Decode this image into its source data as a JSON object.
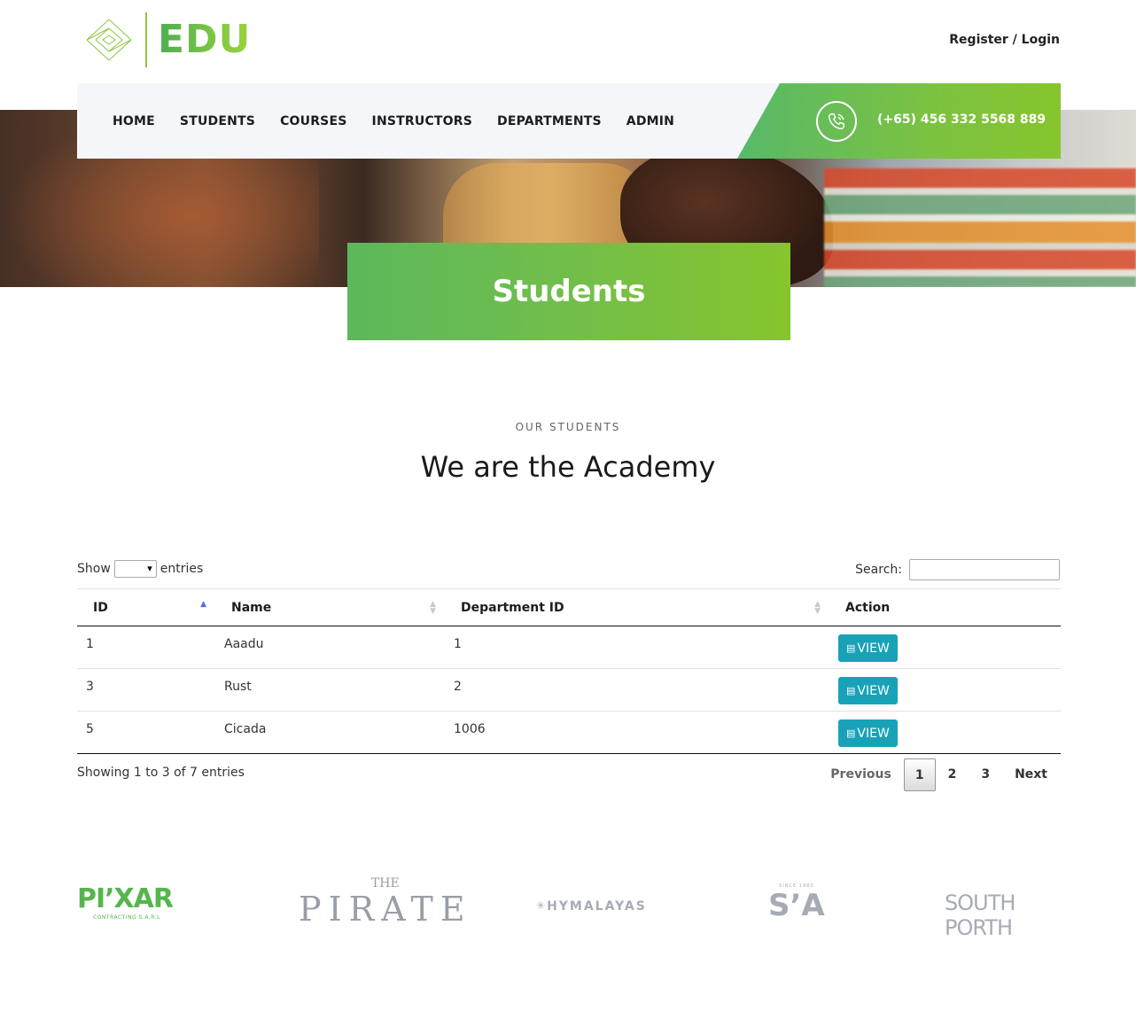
{
  "header": {
    "logo_text": "EDU",
    "register_label": "Register",
    "separator": " / ",
    "login_label": "Login"
  },
  "nav": {
    "items": [
      "HOME",
      "STUDENTS",
      "COURSES",
      "INSTRUCTORS",
      "DEPARTMENTS",
      "ADMIN"
    ],
    "phone": "(+65) 456 332 5568 889",
    "phone_icon": "phone-icon"
  },
  "page": {
    "title": "Students",
    "subtitle": "OUR STUDENTS",
    "headline": "We are the Academy"
  },
  "table": {
    "show_label": "Show",
    "entries_label": "entries",
    "search_label": "Search:",
    "search_value": "",
    "columns": [
      "ID",
      "Name",
      "Department ID",
      "Action"
    ],
    "sorted_column": "ID",
    "rows": [
      {
        "id": "1",
        "name": "Aaadu",
        "department_id": "1",
        "action": "VIEW"
      },
      {
        "id": "3",
        "name": "Rust",
        "department_id": "2",
        "action": "VIEW"
      },
      {
        "id": "5",
        "name": "Cicada",
        "department_id": "1006",
        "action": "VIEW"
      }
    ],
    "info": "Showing 1 to 3 of 7 entries",
    "pagination": {
      "previous": "Previous",
      "pages": [
        "1",
        "2",
        "3"
      ],
      "current": "1",
      "next": "Next"
    },
    "accent_color": "#17a2b8"
  },
  "partners": {
    "pixar": {
      "name": "PI’XAR",
      "tagline": "CONTRACTING S.A.R.L"
    },
    "pirate": {
      "the": "THE",
      "name": "PIRATE"
    },
    "hymalayas": "HYMALAYAS",
    "sa": {
      "since": "SINCE 1980",
      "name": "S’A"
    },
    "southporth": "SOUTH PORTH"
  },
  "colors": {
    "brand_green": "#7cc241",
    "brand_green_dark": "#57b96a",
    "nav_bg": "#f4f6fa"
  }
}
